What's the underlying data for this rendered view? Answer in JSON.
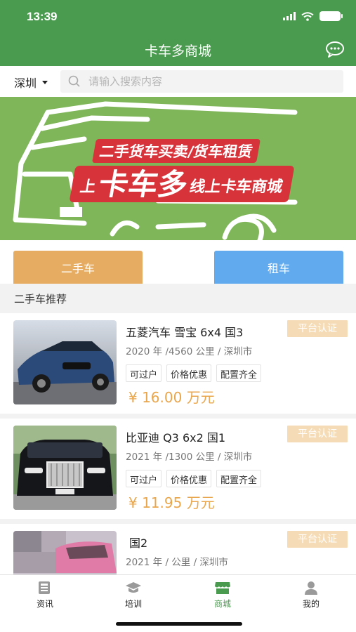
{
  "status_bar": {
    "time": "13:39"
  },
  "header": {
    "title": "卡车多商城",
    "message_icon": "chat-bubble-icon"
  },
  "search": {
    "city": "深圳",
    "placeholder": "请输入搜索内容",
    "value": ""
  },
  "banner": {
    "line1": "二手货车买卖/货车租赁",
    "line2_prefix": "上",
    "line2_brand": "卡车多",
    "line2_suffix": "线上卡车商城"
  },
  "categories": {
    "used": "二手车",
    "rent": "租车"
  },
  "section": {
    "title": "二手车推荐"
  },
  "listings": [
    {
      "name": "五菱汽车 雪宝 6x4 国3",
      "badge": "平台认证",
      "meta": "2020 年 /4560 公里 / 深圳市",
      "tags": [
        "可过户",
        "价格优惠",
        "配置齐全"
      ],
      "price": "¥ 16.00 万元"
    },
    {
      "name": "比亚迪 Q3 6x2 国1",
      "badge": "平台认证",
      "meta": "2021 年 /1300 公里 / 深圳市",
      "tags": [
        "可过户",
        "价格优惠",
        "配置齐全"
      ],
      "price": "¥ 11.95 万元"
    },
    {
      "name": "国2",
      "badge": "平台认证",
      "meta": "2021 年 / 公里 / 深圳市",
      "tags": [],
      "price": ""
    }
  ],
  "tabbar": [
    {
      "label": "资讯",
      "icon": "news-icon"
    },
    {
      "label": "培训",
      "icon": "graduation-cap-icon"
    },
    {
      "label": "商城",
      "icon": "store-icon",
      "active": true
    },
    {
      "label": "我的",
      "icon": "user-icon"
    }
  ],
  "colors": {
    "primary": "#4a9a4f",
    "banner_bg": "#7fb659",
    "banner_red": "#d6333b",
    "used_btn": "#e6ac62",
    "rent_btn": "#61aaee",
    "price": "#e9a64c",
    "badge_bg": "#f6dcb6"
  }
}
